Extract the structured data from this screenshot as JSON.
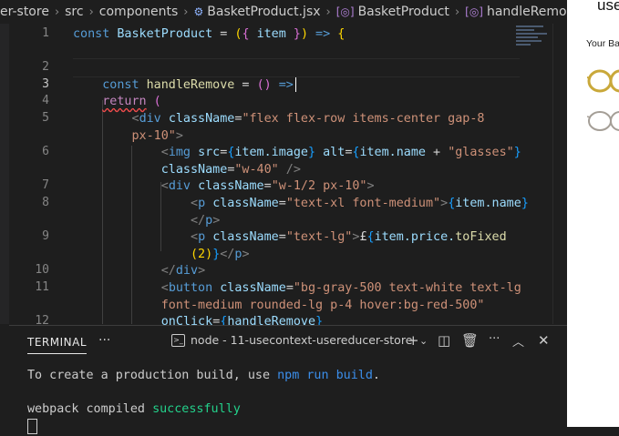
{
  "breadcrumb": {
    "items": [
      "er-store",
      "src",
      "components",
      "BasketProduct.jsx",
      "BasketProduct",
      "handleRemove"
    ],
    "icons": [
      "",
      "",
      "",
      "gear-icon",
      "brackets-icon",
      "method-icon"
    ]
  },
  "editor": {
    "active_line": 3,
    "line_numbers": [
      "1",
      "",
      "2",
      "3",
      "4",
      "5",
      "",
      "6",
      "",
      "7",
      "8",
      "",
      "9",
      "",
      "10",
      "11",
      "",
      "12"
    ],
    "lines": [
      [
        {
          "t": "const ",
          "c": "kw"
        },
        {
          "t": "BasketProduct",
          "c": "var"
        },
        {
          "t": " = ",
          "c": ""
        },
        {
          "t": "(",
          "c": "br1"
        },
        {
          "t": "{ ",
          "c": "br2"
        },
        {
          "t": "item",
          "c": "var"
        },
        {
          "t": " }",
          "c": "br2"
        },
        {
          "t": ")",
          "c": "br1"
        },
        {
          "t": " => ",
          "c": "kw"
        },
        {
          "t": "{",
          "c": "br1"
        }
      ],
      [],
      [
        {
          "t": "    "
        },
        {
          "t": "const ",
          "c": "kw"
        },
        {
          "t": "handleRemove",
          "c": "fn"
        },
        {
          "t": " = ",
          "c": ""
        },
        {
          "t": "()",
          "c": "br2"
        },
        {
          "t": " =>",
          "c": "kw"
        }
      ],
      [
        {
          "t": "    "
        },
        {
          "t": "return",
          "c": "kw2"
        },
        {
          "t": " (",
          "c": "br2"
        }
      ],
      [
        {
          "t": "        "
        },
        {
          "t": "<",
          "c": "punc"
        },
        {
          "t": "div ",
          "c": "tag"
        },
        {
          "t": "className",
          "c": "attr"
        },
        {
          "t": "=",
          "c": ""
        },
        {
          "t": "\"flex flex-row items-center gap-8",
          "c": "str"
        }
      ],
      [
        {
          "t": "        "
        },
        {
          "t": "px-10\"",
          "c": "str"
        },
        {
          "t": ">",
          "c": "punc"
        }
      ],
      [
        {
          "t": "            "
        },
        {
          "t": "<",
          "c": "punc"
        },
        {
          "t": "img ",
          "c": "tag"
        },
        {
          "t": "src",
          "c": "attr"
        },
        {
          "t": "=",
          "c": ""
        },
        {
          "t": "{",
          "c": "br3"
        },
        {
          "t": "item.image",
          "c": "var"
        },
        {
          "t": "}",
          "c": "br3"
        },
        {
          "t": " alt",
          "c": "attr"
        },
        {
          "t": "=",
          "c": ""
        },
        {
          "t": "{",
          "c": "br3"
        },
        {
          "t": "item.name",
          "c": "var"
        },
        {
          "t": " + ",
          "c": ""
        },
        {
          "t": "\"glasses\"",
          "c": "str"
        },
        {
          "t": "}",
          "c": "br3"
        }
      ],
      [
        {
          "t": "            "
        },
        {
          "t": "className",
          "c": "attr"
        },
        {
          "t": "=",
          "c": ""
        },
        {
          "t": "\"w-40\"",
          "c": "str"
        },
        {
          "t": " />",
          "c": "punc"
        }
      ],
      [
        {
          "t": "            "
        },
        {
          "t": "<",
          "c": "punc"
        },
        {
          "t": "div ",
          "c": "tag"
        },
        {
          "t": "className",
          "c": "attr"
        },
        {
          "t": "=",
          "c": ""
        },
        {
          "t": "\"w-1/2 px-10\"",
          "c": "str"
        },
        {
          "t": ">",
          "c": "punc"
        }
      ],
      [
        {
          "t": "                "
        },
        {
          "t": "<",
          "c": "punc"
        },
        {
          "t": "p ",
          "c": "tag"
        },
        {
          "t": "className",
          "c": "attr"
        },
        {
          "t": "=",
          "c": ""
        },
        {
          "t": "\"text-xl font-medium\"",
          "c": "str"
        },
        {
          "t": ">",
          "c": "punc"
        },
        {
          "t": "{",
          "c": "br3"
        },
        {
          "t": "item.name",
          "c": "var"
        },
        {
          "t": "}",
          "c": "br3"
        }
      ],
      [
        {
          "t": "                "
        },
        {
          "t": "</",
          "c": "punc"
        },
        {
          "t": "p",
          "c": "tag"
        },
        {
          "t": ">",
          "c": "punc"
        }
      ],
      [
        {
          "t": "                "
        },
        {
          "t": "<",
          "c": "punc"
        },
        {
          "t": "p ",
          "c": "tag"
        },
        {
          "t": "className",
          "c": "attr"
        },
        {
          "t": "=",
          "c": ""
        },
        {
          "t": "\"text-lg\"",
          "c": "str"
        },
        {
          "t": ">",
          "c": "punc"
        },
        {
          "t": "£",
          "c": ""
        },
        {
          "t": "{",
          "c": "br3"
        },
        {
          "t": "item.price.",
          "c": "var"
        },
        {
          "t": "toFixed",
          "c": "fn"
        }
      ],
      [
        {
          "t": "                "
        },
        {
          "t": "(2)",
          "c": "br1"
        },
        {
          "t": "}",
          "c": "br3"
        },
        {
          "t": "</",
          "c": "punc"
        },
        {
          "t": "p",
          "c": "tag"
        },
        {
          "t": ">",
          "c": "punc"
        }
      ],
      [
        {
          "t": "            "
        },
        {
          "t": "</",
          "c": "punc"
        },
        {
          "t": "div",
          "c": "tag"
        },
        {
          "t": ">",
          "c": "punc"
        }
      ],
      [
        {
          "t": "            "
        },
        {
          "t": "<",
          "c": "punc"
        },
        {
          "t": "button ",
          "c": "tag"
        },
        {
          "t": "className",
          "c": "attr"
        },
        {
          "t": "=",
          "c": ""
        },
        {
          "t": "\"bg-gray-500 text-white text-lg",
          "c": "str"
        }
      ],
      [
        {
          "t": "            "
        },
        {
          "t": "font-medium rounded-lg p-4 hover:bg-red-500\"",
          "c": "str"
        }
      ],
      [
        {
          "t": "            "
        },
        {
          "t": "onClick",
          "c": "attr"
        },
        {
          "t": "=",
          "c": ""
        },
        {
          "t": "{",
          "c": "br3"
        },
        {
          "t": "handleRemove",
          "c": "var"
        },
        {
          "t": "}",
          "c": "br3"
        }
      ]
    ]
  },
  "terminal": {
    "tab_label": "TERMINAL",
    "more_label": "···",
    "select_label": "node - 11-usecontext-usereducer-store",
    "output": [
      [
        {
          "t": "To create a production build, use "
        },
        {
          "t": "npm run build",
          "c": "t-accent"
        },
        {
          "t": "."
        }
      ],
      [],
      [
        {
          "t": "webpack compiled "
        },
        {
          "t": "successfully",
          "c": "t-success"
        }
      ]
    ]
  },
  "browser": {
    "title": "use",
    "subtitle": "Your Ba"
  },
  "colors": {
    "editor_bg": "#1e1e1e",
    "keyword": "#569cd6",
    "string": "#ce9178",
    "attribute": "#9cdcfe",
    "success": "#23d18b",
    "accent": "#3b8eea"
  }
}
